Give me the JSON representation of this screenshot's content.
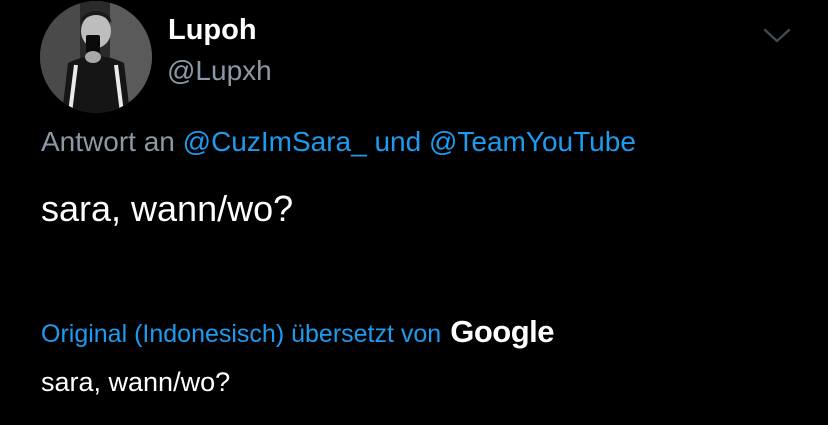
{
  "colors": {
    "background": "#000000",
    "text_primary": "#ffffff",
    "text_secondary": "#8b98a5",
    "link": "#1d9bf0"
  },
  "author": {
    "display_name": "Lupoh",
    "handle": "@Lupxh",
    "avatar_icon": "profile-photo"
  },
  "menu": {
    "icon": "chevron-down-icon"
  },
  "reply": {
    "prefix": "Antwort an",
    "mention_1": "@CuzImSara_",
    "conjunction": "und",
    "mention_2": "@TeamYouTube"
  },
  "tweet": {
    "text": "sara, wann/wo?"
  },
  "translation": {
    "label": "Original (Indonesisch) übersetzt von",
    "provider": "Google",
    "text": "sara, wann/wo?"
  }
}
